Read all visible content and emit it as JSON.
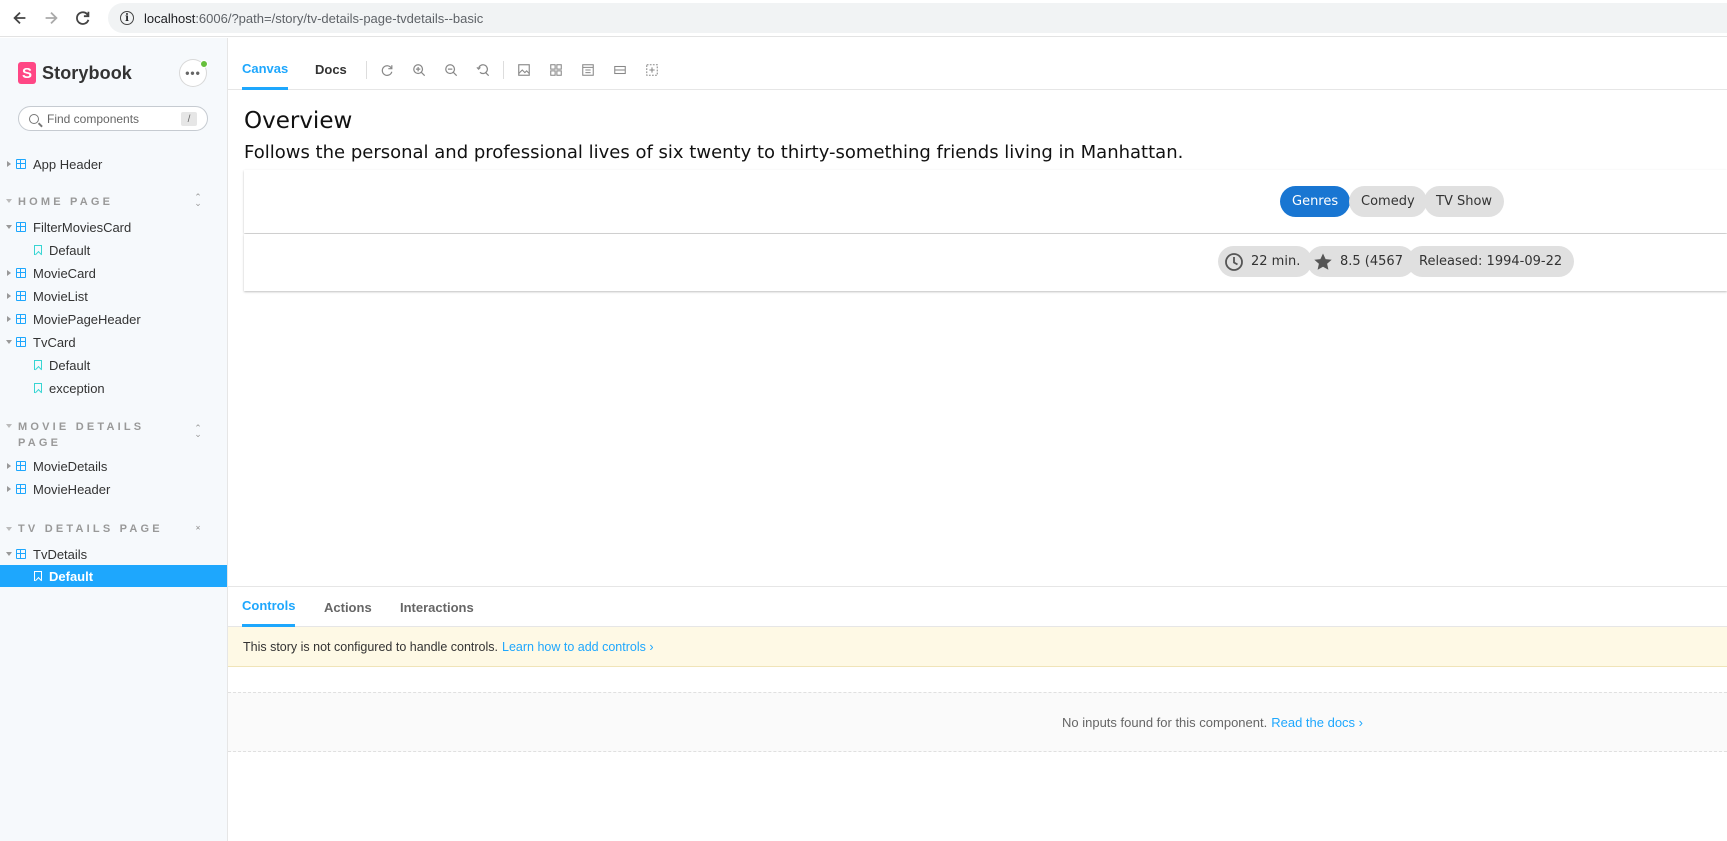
{
  "browser": {
    "url_host": "localhost",
    "url_path": ":6006/?path=/story/tv-details-page-tvdetails--basic"
  },
  "sidebar": {
    "brand": "Storybook",
    "brand_logo": "S",
    "menu_label": "•••",
    "search_placeholder": "Find components",
    "search_shortcut": "/",
    "root_item": "App Header",
    "sections": [
      {
        "title": "HOME PAGE",
        "items": [
          "FilterMoviesCard",
          "Default",
          "MovieCard",
          "MovieList",
          "MoviePageHeader",
          "TvCard",
          "Default",
          "exception"
        ]
      },
      {
        "title_line1": "MOVIE DETAILS",
        "title_line2": "PAGE",
        "items": [
          "MovieDetails",
          "MovieHeader"
        ]
      },
      {
        "title": "TV DETAILS PAGE",
        "items": [
          "TvDetails",
          "Default"
        ]
      }
    ]
  },
  "toolbar": {
    "tabs": [
      "Canvas",
      "Docs"
    ],
    "active_tab": "Canvas",
    "icons": [
      "refresh-icon",
      "zoom-in-icon",
      "zoom-out-icon",
      "zoom-reset-icon",
      "background-icon",
      "grid-icon",
      "viewport-icon",
      "measure-icon",
      "outline-icon"
    ]
  },
  "canvas": {
    "title": "Overview",
    "description": "Follows the personal and professional lives of six twenty to thirty-something friends living in Manhattan.",
    "genre_chips": [
      "Genres",
      "Comedy",
      "TV Show"
    ],
    "info_chips": {
      "runtime": "22 min.",
      "rating": "8.5 (4567",
      "released": "Released: 1994-09-22"
    }
  },
  "addons": {
    "tabs": [
      "Controls",
      "Actions",
      "Interactions"
    ],
    "active_tab": "Controls",
    "notice_text": "This story is not configured to handle controls.",
    "notice_link": "Learn how to add controls ›",
    "empty_text": "No inputs found for this component.",
    "empty_link": "Read the docs ›"
  },
  "colors": {
    "accent": "#1ea7fd",
    "brand": "#ff4785",
    "chip_primary": "#1976d2",
    "notice_bg": "#fef9e5"
  }
}
